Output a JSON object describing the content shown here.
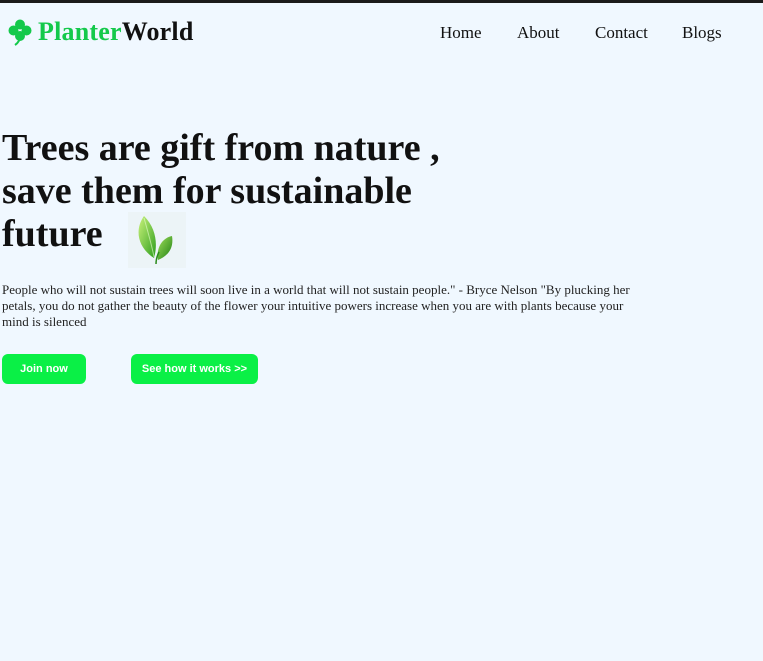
{
  "header": {
    "logo_part1": "Planter",
    "logo_part2": "World",
    "logo_icon": "clover-icon",
    "nav": [
      {
        "label": "Home"
      },
      {
        "label": "About"
      },
      {
        "label": "Contact"
      },
      {
        "label": "Blogs"
      }
    ]
  },
  "hero": {
    "headline": "Trees are gift from nature , save them for sustainable future",
    "leaf_icon": "leaf-icon",
    "quote": "People who will not sustain trees will soon live in a world that will not sustain people.\" - Bryce Nelson \"By plucking her petals, you do not gather the beauty of the flower your intuitive powers increase when you are with plants because your mind is silenced",
    "buttons": {
      "join": "Join now",
      "how": "See how it works >>"
    }
  },
  "colors": {
    "background": "#f0f8ff",
    "brand_green": "#14c94b",
    "button_green": "#0af046",
    "text": "#111111"
  }
}
